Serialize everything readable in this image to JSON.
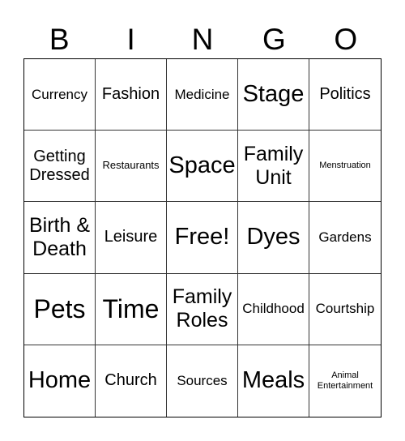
{
  "header": {
    "letters": [
      "B",
      "I",
      "N",
      "G",
      "O"
    ]
  },
  "board": {
    "rows": [
      [
        {
          "text": "Currency",
          "size": "md"
        },
        {
          "text": "Fashion",
          "size": "lg"
        },
        {
          "text": "Medicine",
          "size": "md"
        },
        {
          "text": "Stage",
          "size": "xxl"
        },
        {
          "text": "Politics",
          "size": "lg"
        }
      ],
      [
        {
          "text": "Getting Dressed",
          "size": "lg"
        },
        {
          "text": "Restaurants",
          "size": "sm"
        },
        {
          "text": "Space",
          "size": "xxl"
        },
        {
          "text": "Family Unit",
          "size": "xl"
        },
        {
          "text": "Menstruation",
          "size": "xs"
        }
      ],
      [
        {
          "text": "Birth & Death",
          "size": "xl"
        },
        {
          "text": "Leisure",
          "size": "lg"
        },
        {
          "text": "Free!",
          "size": "xxl"
        },
        {
          "text": "Dyes",
          "size": "xxl"
        },
        {
          "text": "Gardens",
          "size": "md"
        }
      ],
      [
        {
          "text": "Pets",
          "size": "xxxl"
        },
        {
          "text": "Time",
          "size": "xxxl"
        },
        {
          "text": "Family Roles",
          "size": "xl"
        },
        {
          "text": "Childhood",
          "size": "md"
        },
        {
          "text": "Courtship",
          "size": "md"
        }
      ],
      [
        {
          "text": "Home",
          "size": "xxl"
        },
        {
          "text": "Church",
          "size": "lg"
        },
        {
          "text": "Sources",
          "size": "md"
        },
        {
          "text": "Meals",
          "size": "xxl"
        },
        {
          "text": "Animal Entertainment",
          "size": "xs"
        }
      ]
    ]
  }
}
